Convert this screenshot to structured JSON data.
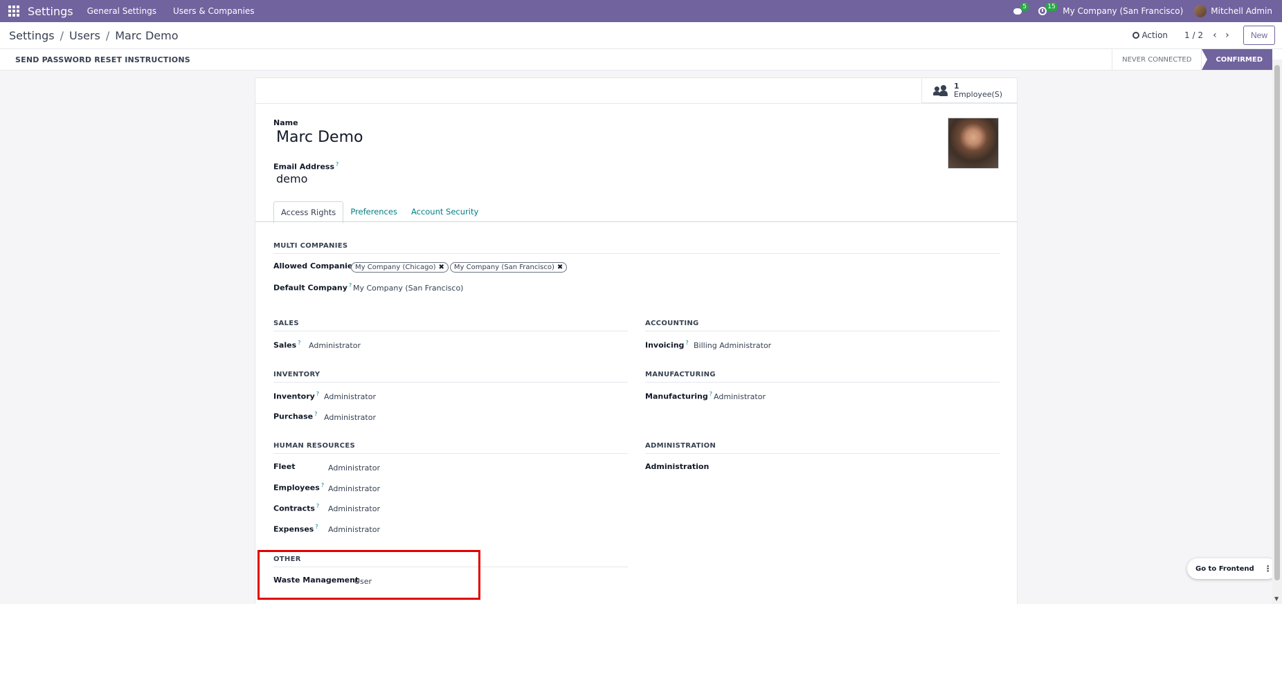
{
  "navbar": {
    "app_name": "Settings",
    "menu": [
      "General Settings",
      "Users & Companies"
    ],
    "messages_count": "5",
    "activities_count": "15",
    "company": "My Company (San Francisco)",
    "user": "Mitchell Admin"
  },
  "control_panel": {
    "breadcrumb": [
      "Settings",
      "Users",
      "Marc Demo"
    ],
    "action_label": "Action",
    "pager": "1 / 2",
    "new_label": "New"
  },
  "statusbar": {
    "reset_label": "SEND PASSWORD RESET INSTRUCTIONS",
    "stages": [
      "NEVER CONNECTED",
      "CONFIRMED"
    ],
    "active_stage": "CONFIRMED"
  },
  "form": {
    "employee_count": "1",
    "employee_label": "Employee(S)",
    "name_label": "Name",
    "name": "Marc Demo",
    "email_label": "Email Address",
    "email": "demo",
    "tabs": [
      "Access Rights",
      "Preferences",
      "Account Security"
    ],
    "active_tab": "Access Rights",
    "multi_companies": {
      "title": "MULTI COMPANIES",
      "allowed_label": "Allowed Companies",
      "allowed": [
        "My Company (Chicago)",
        "My Company (San Francisco)"
      ],
      "default_label": "Default Company",
      "default": "My Company (San Francisco)"
    },
    "sales": {
      "title": "SALES",
      "label": "Sales",
      "value": "Administrator"
    },
    "accounting": {
      "title": "ACCOUNTING",
      "label": "Invoicing",
      "value": "Billing Administrator"
    },
    "inventory": {
      "title": "INVENTORY",
      "rows": [
        {
          "label": "Inventory",
          "value": "Administrator"
        },
        {
          "label": "Purchase",
          "value": "Administrator"
        }
      ]
    },
    "manufacturing": {
      "title": "MANUFACTURING",
      "label": "Manufacturing",
      "value": "Administrator"
    },
    "human_resources": {
      "title": "HUMAN RESOURCES",
      "rows": [
        {
          "label": "Fleet",
          "value": "Administrator"
        },
        {
          "label": "Employees",
          "value": "Administrator"
        },
        {
          "label": "Contracts",
          "value": "Administrator"
        },
        {
          "label": "Expenses",
          "value": "Administrator"
        }
      ]
    },
    "administration": {
      "title": "ADMINISTRATION",
      "label": "Administration"
    },
    "other": {
      "title": "OTHER",
      "label": "Waste Management",
      "value": "User"
    }
  },
  "floating": {
    "go_frontend": "Go to Frontend"
  },
  "colors": {
    "brand": "#71639e",
    "link": "#017e84",
    "highlight": "#e10000"
  }
}
